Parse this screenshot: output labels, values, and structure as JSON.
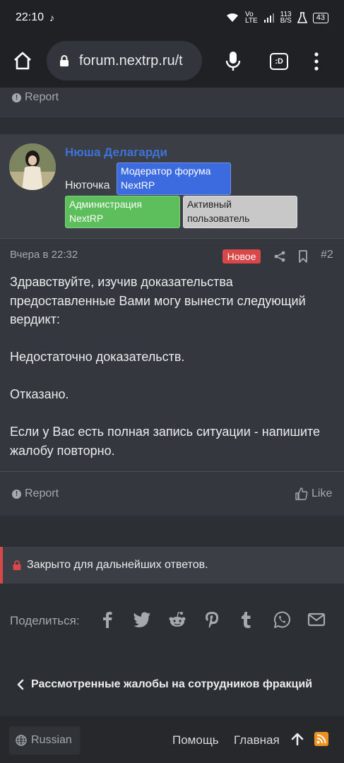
{
  "statusbar": {
    "time": "22:10",
    "net_top": "Vo",
    "net_bottom": "LTE",
    "speed_top": "113",
    "speed_bottom": "B/S",
    "battery": "43"
  },
  "browser": {
    "url": "forum.nextrp.ru/t",
    "tabs_label": ":D"
  },
  "top_block": {
    "report": "Report"
  },
  "post": {
    "author_name": "Нюша Делагарди",
    "user_title": "Нюточка",
    "badges": {
      "moderator": "Модератор форума NextRP",
      "admin": "Администрация NextRP",
      "active": "Активный пользователь"
    },
    "date": "Вчера в 22:32",
    "new_label": "Новое",
    "number": "#2",
    "paragraphs": [
      "Здравствуйте, изучив доказательства предоставленные Вами могу вынести следующий вердикт:",
      "Недостаточно доказательств.",
      "Отказано.",
      "Если у Вас есть полная запись ситуации - напишите жалобу повторно."
    ],
    "report": "Report",
    "like": "Like"
  },
  "closed_notice": "Закрыто для дальнейших ответов.",
  "share": {
    "label": "Поделиться:",
    "icons": [
      "facebook-icon",
      "twitter-icon",
      "reddit-icon",
      "pinterest-icon",
      "tumblr-icon",
      "whatsapp-icon",
      "email-icon"
    ]
  },
  "breadcrumb": "Рассмотренные жалобы на сотрудников фракций",
  "footer": {
    "language": "Russian",
    "help": "Помощь",
    "home": "Главная"
  },
  "colors": {
    "accent_blue": "#3c6be0",
    "username": "#3d73d8",
    "admin_green": "#5cbf5c",
    "new_red": "#d94848",
    "rss_orange": "#f0901e"
  }
}
